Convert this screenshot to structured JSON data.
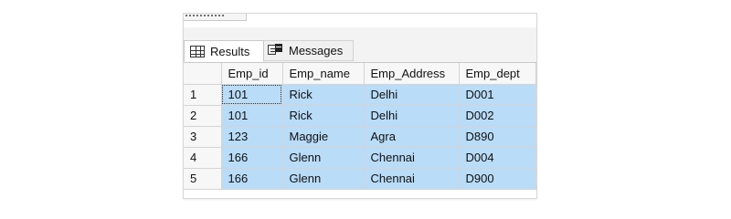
{
  "tabs": {
    "results_label": "Results",
    "messages_label": "Messages",
    "results_icon": "grid-icon",
    "messages_icon": "messages-icon"
  },
  "grid": {
    "columns": [
      "Emp_id",
      "Emp_name",
      "Emp_Address",
      "Emp_dept"
    ],
    "rows": [
      {
        "num": "1",
        "emp_id": "101",
        "emp_name": "Rick",
        "emp_address": "Delhi",
        "emp_dept": "D001"
      },
      {
        "num": "2",
        "emp_id": "101",
        "emp_name": "Rick",
        "emp_address": "Delhi",
        "emp_dept": "D002"
      },
      {
        "num": "3",
        "emp_id": "123",
        "emp_name": "Maggie",
        "emp_address": "Agra",
        "emp_dept": "D890"
      },
      {
        "num": "4",
        "emp_id": "166",
        "emp_name": "Glenn",
        "emp_address": "Chennai",
        "emp_dept": "D004"
      },
      {
        "num": "5",
        "emp_id": "166",
        "emp_name": "Glenn",
        "emp_address": "Chennai",
        "emp_dept": "D900"
      }
    ]
  },
  "colors": {
    "selection_fill": "#b9dcf8",
    "header_fill": "#f7f7f7",
    "grid_line": "#d4d4d4"
  }
}
